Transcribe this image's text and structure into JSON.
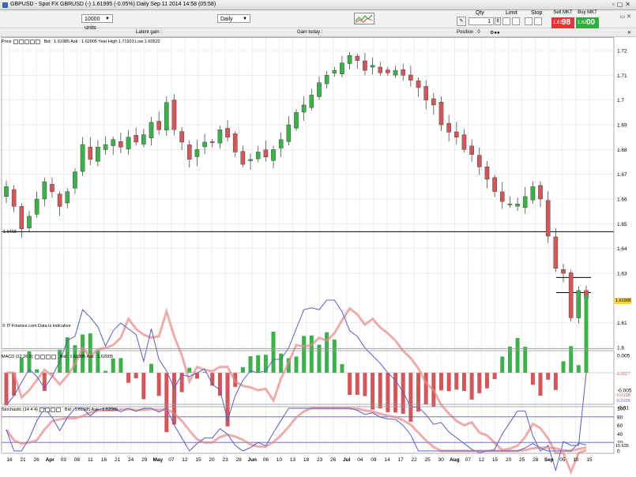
{
  "window": {
    "title": "GBPUSD - Spot FX GBRUSD (-)     1.61995 (-0.05%)     Daily   Sep 11 2014 14:58 (05:58)"
  },
  "toolbar": {
    "units": "10000 units",
    "period": "Daily",
    "qty_label": "Qty",
    "qty_value": "1",
    "limit_label": "Limit",
    "stop_label": "Stop",
    "sell_label": "Sell MKT",
    "buy_label": "Buy MKT",
    "sell_small": "1.61",
    "sell_big": "98",
    "buy_small": "1.62",
    "buy_big": "00"
  },
  "infobar": {
    "latent_gain": "Latent gain :",
    "gain_today": "Gain today :",
    "position": "Position : 0"
  },
  "price_panel": {
    "label": "Price",
    "header_info": "Bid : 1.61985  Ask : 1.62005  Year High 1.71923  Low 1.60522",
    "footer": "© IT-Finance.com  Data is indicative",
    "hline_label": "1.6468",
    "current_label": "1.61995",
    "ticks": [
      "1.72",
      "1.71",
      "1.7",
      "1.69",
      "1.68",
      "1.67",
      "1.66",
      "1.65",
      "1.64",
      "1.63",
      "1.61",
      "1.6"
    ]
  },
  "macd_panel": {
    "label": "MACD (12 26 9)",
    "header_info": "Bid : 1.61985  Ask : 1.62005",
    "ticks": [
      "0.005",
      "0",
      "-0.005",
      "-0.01"
    ],
    "tag_red": "-0.0138",
    "tag_blue": "-0.0105",
    "tag_grey": "-0.0027"
  },
  "stoch_panel": {
    "label": "Stochastic (14 4 4)",
    "header_info": "Bid : 1.61985  Ask : 1.62005",
    "ticks": [
      "100",
      "80",
      "60",
      "40",
      "20",
      "0"
    ],
    "tag": "15.635"
  },
  "date_axis": [
    "16",
    "21",
    "26",
    "Apr",
    "03",
    "08",
    "11",
    "16",
    "21",
    "24",
    "29",
    "May",
    "07",
    "12",
    "15",
    "20",
    "23",
    "28",
    "Jun",
    "06",
    "10",
    "13",
    "18",
    "23",
    "26",
    "Jul",
    "04",
    "09",
    "14",
    "17",
    "22",
    "25",
    "30",
    "Aug",
    "07",
    "12",
    "15",
    "20",
    "25",
    "28",
    "Sep",
    "05",
    "10",
    "15"
  ],
  "colors": {
    "up": "#3cb04a",
    "down": "#d2575b",
    "accent_red": "#e03737",
    "accent_green": "#2eae3a",
    "grid": "#e3e3e3"
  },
  "chart_data": {
    "type": "candlestick",
    "instrument": "GBPUSD",
    "interval": "Daily",
    "price_ylim": [
      1.6,
      1.723
    ],
    "horizontal_line": 1.6468,
    "last_price": 1.61995,
    "close_trend": [
      1.665,
      1.657,
      1.648,
      1.653,
      1.66,
      1.667,
      1.663,
      1.657,
      1.663,
      1.671,
      1.682,
      1.676,
      1.681,
      1.682,
      1.684,
      1.681,
      1.685,
      1.683,
      1.686,
      1.691,
      1.688,
      1.699,
      1.688,
      1.683,
      1.676,
      1.68,
      1.683,
      1.683,
      1.688,
      1.685,
      1.679,
      1.674,
      1.676,
      1.679,
      1.677,
      1.68,
      1.684,
      1.69,
      1.695,
      1.698,
      1.702,
      1.707,
      1.71,
      1.712,
      1.715,
      1.718,
      1.716,
      1.712,
      1.714,
      1.711,
      1.711,
      1.712,
      1.71,
      1.708,
      1.705,
      1.7,
      1.698,
      1.69,
      1.687,
      1.685,
      1.68,
      1.678,
      1.673,
      1.668,
      1.663,
      1.659,
      1.658,
      1.658,
      1.661,
      1.665,
      1.66,
      1.645,
      1.632,
      1.63,
      1.612,
      1.623,
      1.62
    ],
    "macd_ylim": [
      -0.015,
      0.008
    ],
    "stochastic_ylim": [
      0,
      100
    ]
  }
}
